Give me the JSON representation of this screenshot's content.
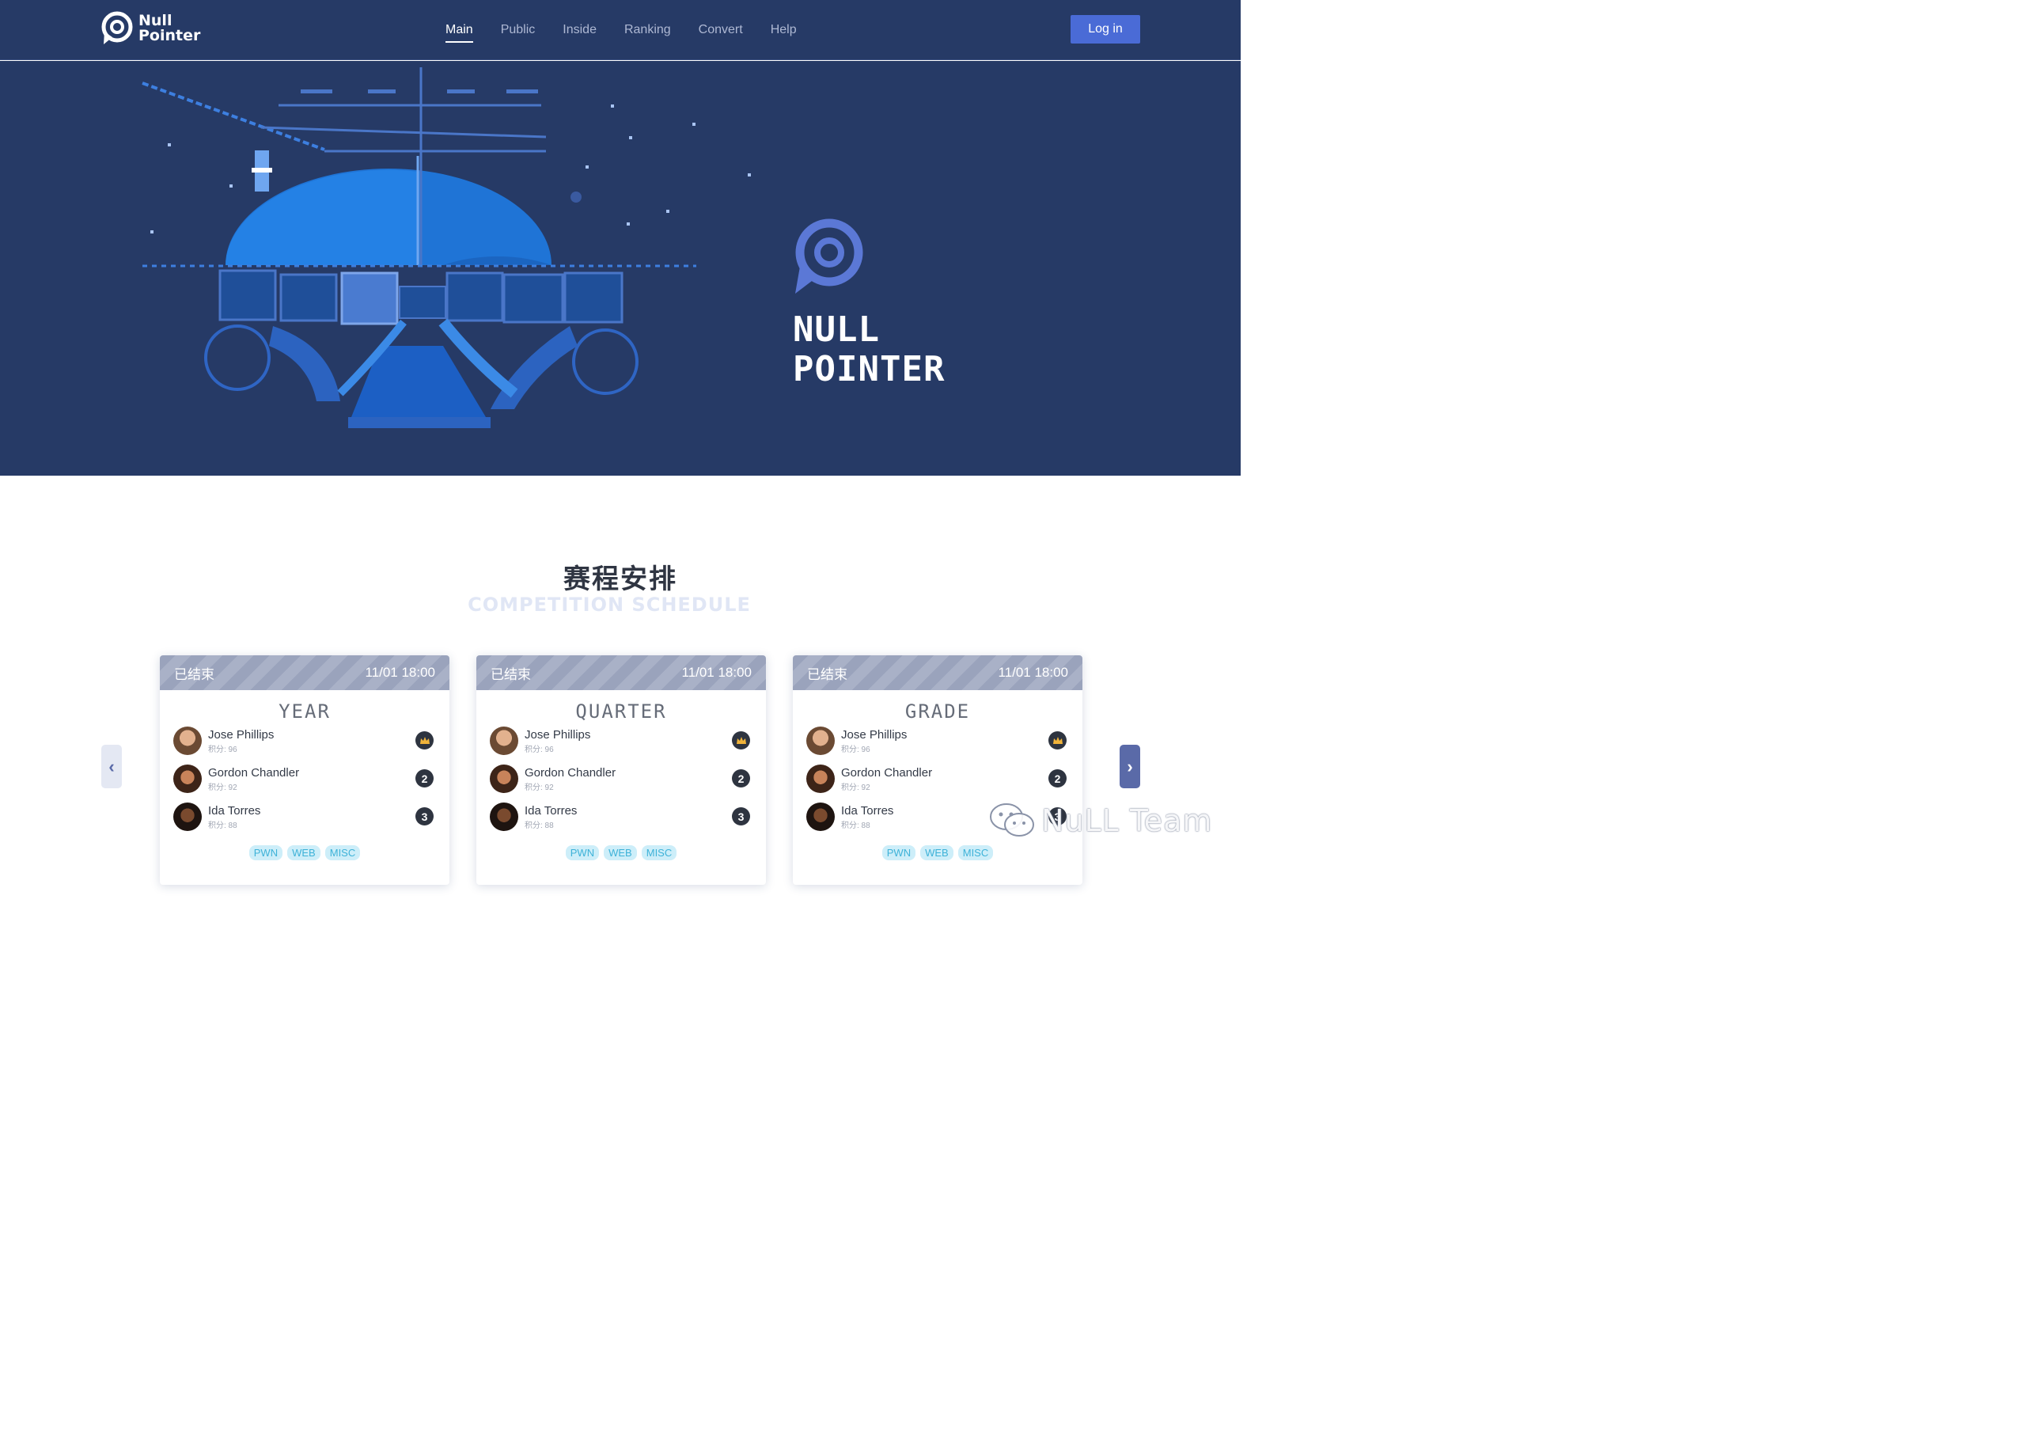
{
  "header": {
    "logo_line1": "Null",
    "logo_line2": "Pointer",
    "nav": [
      {
        "label": "Main",
        "active": true
      },
      {
        "label": "Public",
        "active": false
      },
      {
        "label": "Inside",
        "active": false
      },
      {
        "label": "Ranking",
        "active": false
      },
      {
        "label": "Convert",
        "active": false
      },
      {
        "label": "Help",
        "active": false
      }
    ],
    "login_label": "Log in"
  },
  "hero": {
    "brand_line1": "NULL",
    "brand_line2": "POINTER"
  },
  "schedule": {
    "title": "赛程安排",
    "subtitle": "COMPETITION SCHEDULE",
    "cards": [
      {
        "status": "已结束",
        "time": "11/01 18:00",
        "name": "YEAR",
        "players": [
          {
            "name": "Jose Phillips",
            "score": "积分: 96",
            "rank": "crown"
          },
          {
            "name": "Gordon Chandler",
            "score": "积分: 92",
            "rank": "2"
          },
          {
            "name": "Ida Torres",
            "score": "积分: 88",
            "rank": "3"
          }
        ],
        "tags": [
          "PWN",
          "WEB",
          "MISC"
        ]
      },
      {
        "status": "已结束",
        "time": "11/01 18:00",
        "name": "QUARTER",
        "players": [
          {
            "name": "Jose Phillips",
            "score": "积分: 96",
            "rank": "crown"
          },
          {
            "name": "Gordon Chandler",
            "score": "积分: 92",
            "rank": "2"
          },
          {
            "name": "Ida Torres",
            "score": "积分: 88",
            "rank": "3"
          }
        ],
        "tags": [
          "PWN",
          "WEB",
          "MISC"
        ]
      },
      {
        "status": "已结束",
        "time": "11/01 18:00",
        "name": "GRADE",
        "players": [
          {
            "name": "Jose Phillips",
            "score": "积分: 96",
            "rank": "crown"
          },
          {
            "name": "Gordon Chandler",
            "score": "积分: 92",
            "rank": "2"
          },
          {
            "name": "Ida Torres",
            "score": "积分: 88",
            "rank": "3"
          }
        ],
        "tags": [
          "PWN",
          "WEB",
          "MISC"
        ]
      }
    ]
  },
  "watermark": "NuLL Team",
  "colors": {
    "navy": "#263a66",
    "accent": "#4a6bd6",
    "tag_bg": "#cdeef9",
    "tag_text": "#3eb2d8"
  }
}
